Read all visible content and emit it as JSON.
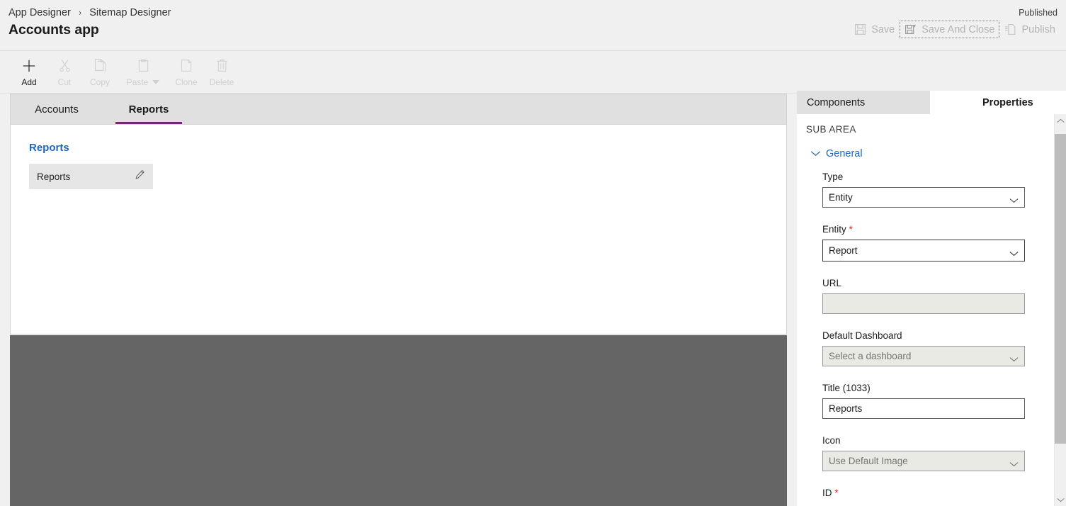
{
  "header": {
    "breadcrumb": [
      "App Designer",
      "Sitemap Designer"
    ],
    "breadcrumb_separator": "›",
    "app_title": "Accounts app",
    "status": "Published",
    "actions": [
      {
        "label": "Save",
        "icon": "save-icon",
        "enabled": false,
        "focused": false
      },
      {
        "label": "Save And Close",
        "icon": "save-and-close-icon",
        "enabled": false,
        "focused": true
      },
      {
        "label": "Publish",
        "icon": "publish-icon",
        "enabled": false,
        "focused": false
      }
    ]
  },
  "command_bar": {
    "items": [
      {
        "label": "Add",
        "icon": "plus-icon",
        "enabled": true,
        "has_caret": false
      },
      {
        "label": "Cut",
        "icon": "scissors-icon",
        "enabled": false,
        "has_caret": false
      },
      {
        "label": "Copy",
        "icon": "copy-icon",
        "enabled": false,
        "has_caret": false
      },
      {
        "label": "Paste",
        "icon": "paste-icon",
        "enabled": false,
        "has_caret": true
      },
      {
        "label": "Clone",
        "icon": "clone-icon",
        "enabled": false,
        "has_caret": false
      },
      {
        "label": "Delete",
        "icon": "trash-icon",
        "enabled": false,
        "has_caret": false
      }
    ]
  },
  "canvas": {
    "tabs": [
      {
        "label": "Accounts",
        "active": false
      },
      {
        "label": "Reports",
        "active": true
      }
    ],
    "active_tab_accent": "#742774",
    "group_title": "Reports",
    "group_title_color": "#2266b8",
    "subarea": {
      "name": "Reports",
      "edit_icon": "pencil-icon",
      "selected": true
    }
  },
  "properties_panel": {
    "tabs": [
      {
        "label": "Components",
        "active": false
      },
      {
        "label": "Properties",
        "active": true
      }
    ],
    "section_header": "SUB AREA",
    "group": {
      "label": "General",
      "expanded": true,
      "chevron_icon": "chevron-down-icon",
      "color": "#2266b8"
    },
    "fields": [
      {
        "label": "Type",
        "required": false,
        "control": "select",
        "value": "Entity",
        "placeholder": "",
        "enabled": true,
        "focused": false,
        "chevron_icon": "chevron-down-icon"
      },
      {
        "label": "Entity",
        "required": true,
        "control": "select",
        "value": "Report",
        "placeholder": "",
        "enabled": true,
        "focused": true,
        "chevron_icon": "chevron-down-icon"
      },
      {
        "label": "URL",
        "required": false,
        "control": "text",
        "value": "",
        "placeholder": "",
        "enabled": false,
        "focused": false,
        "chevron_icon": ""
      },
      {
        "label": "Default Dashboard",
        "required": false,
        "control": "select",
        "value": "",
        "placeholder": "Select a dashboard",
        "enabled": false,
        "focused": false,
        "chevron_icon": "chevron-down-icon"
      },
      {
        "label": "Title (1033)",
        "required": false,
        "control": "text",
        "value": "Reports",
        "placeholder": "",
        "enabled": true,
        "focused": false,
        "chevron_icon": ""
      },
      {
        "label": "Icon",
        "required": false,
        "control": "select",
        "value": "",
        "placeholder": "Use Default Image",
        "enabled": false,
        "focused": false,
        "chevron_icon": "chevron-down-icon"
      },
      {
        "label": "ID",
        "required": true,
        "control": "text",
        "value": "",
        "placeholder": "",
        "enabled": true,
        "focused": false,
        "chevron_icon": ""
      }
    ],
    "scrollbar": {
      "up_icon": "chevron-up-icon",
      "down_icon": "chevron-down-icon"
    }
  }
}
